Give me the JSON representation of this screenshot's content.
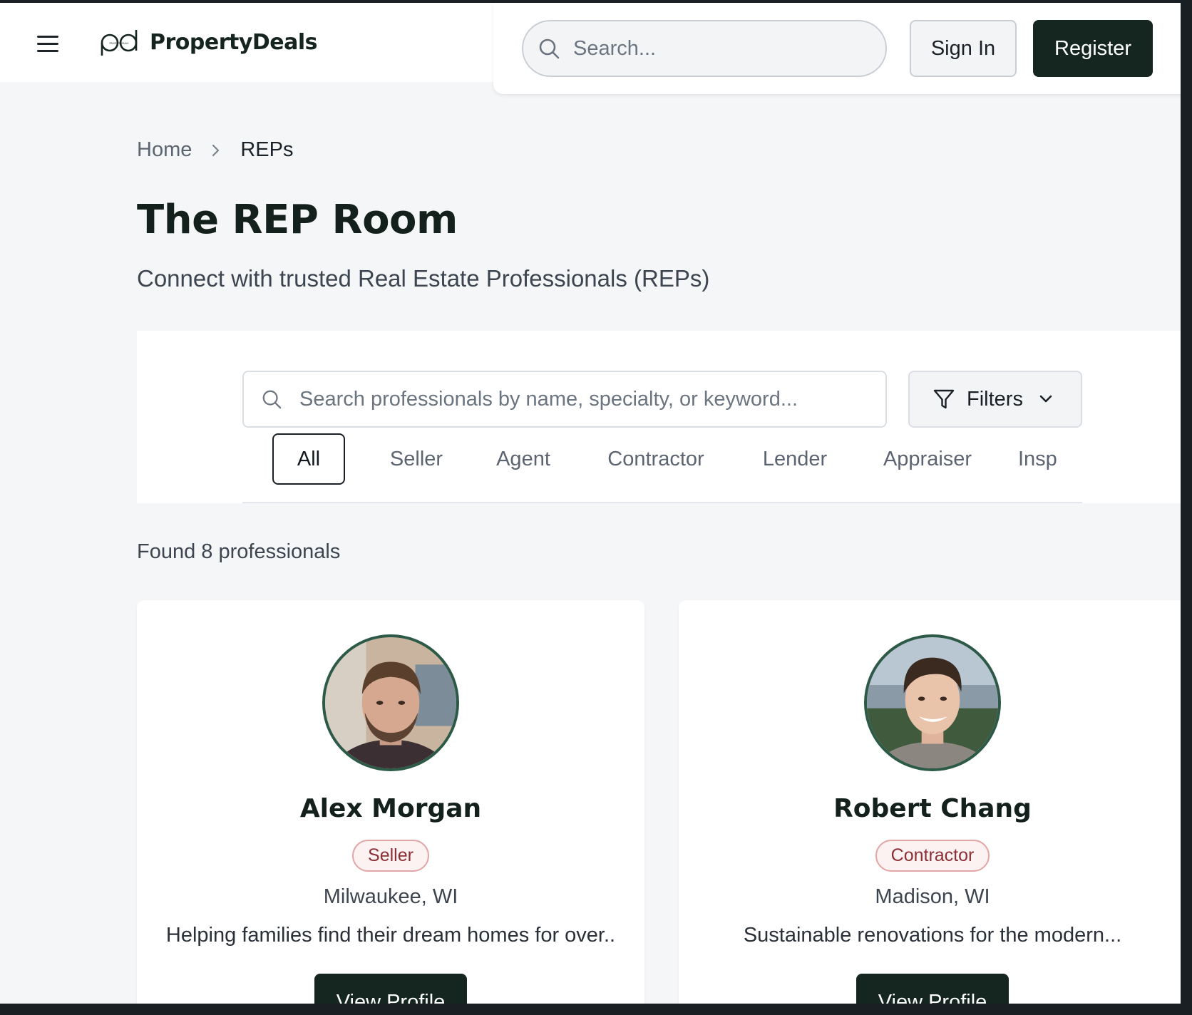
{
  "header": {
    "brand": "PropertyDeals",
    "logo_small_text": "PROPERTYDEALS",
    "search_placeholder": "Search...",
    "sign_in_label": "Sign In",
    "register_label": "Register"
  },
  "breadcrumb": {
    "home": "Home",
    "current": "REPs"
  },
  "page": {
    "title": "The REP Room",
    "subtitle": "Connect with trusted Real Estate Professionals (REPs)"
  },
  "filters": {
    "search_placeholder": "Search professionals by name, specialty, or keyword...",
    "filters_label": "Filters",
    "tabs": [
      {
        "label": "All",
        "active": true
      },
      {
        "label": "Seller",
        "active": false
      },
      {
        "label": "Agent",
        "active": false
      },
      {
        "label": "Contractor",
        "active": false
      },
      {
        "label": "Lender",
        "active": false
      },
      {
        "label": "Appraiser",
        "active": false
      },
      {
        "label": "Insp",
        "active": false
      }
    ]
  },
  "results": {
    "count_text": "Found 8 professionals",
    "cards": [
      {
        "name": "Alex Morgan",
        "role": "Seller",
        "location": "Milwaukee, WI",
        "description": "Helping families find their dream homes for over..",
        "button_label": "View Profile"
      },
      {
        "name": "Robert Chang",
        "role": "Contractor",
        "location": "Madison, WI",
        "description": "Sustainable renovations for the modern...",
        "button_label": "View Profile"
      }
    ]
  },
  "colors": {
    "brand_dark": "#152520",
    "badge_border": "#e3a6a6",
    "badge_text": "#8c2f35",
    "avatar_ring": "#2c5a47",
    "page_bg": "#f5f6f8"
  },
  "icons": [
    "menu-icon",
    "logo-icon",
    "search-icon",
    "chevron-right-icon",
    "filter-icon",
    "chevron-down-icon"
  ]
}
